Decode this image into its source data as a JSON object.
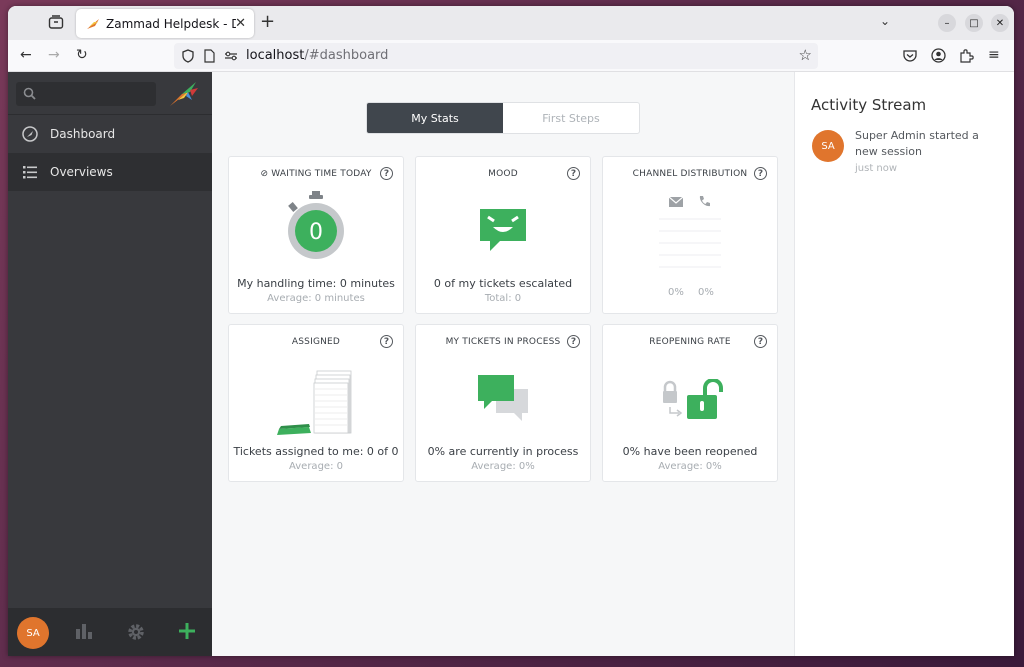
{
  "browser": {
    "tab_title": "Zammad Helpdesk - Dash",
    "url_host": "localhost",
    "url_path": "/#dashboard"
  },
  "sidebar": {
    "items": [
      {
        "label": "Dashboard",
        "icon": "dashboard-icon"
      },
      {
        "label": "Overviews",
        "icon": "list-icon"
      }
    ],
    "avatar_initials": "SA"
  },
  "dashboard": {
    "toggle": {
      "left": "My Stats",
      "right": "First Steps",
      "active": "left"
    },
    "cards": [
      {
        "title": "WAITING TIME TODAY",
        "main": "My handling time: 0 minutes",
        "sub": "Average: 0 minutes",
        "value": "0"
      },
      {
        "title": "MOOD",
        "main": "0 of my tickets escalated",
        "sub": "Total: 0"
      },
      {
        "title": "CHANNEL DISTRIBUTION",
        "pct_email": "0%",
        "pct_phone": "0%"
      },
      {
        "title": "ASSIGNED",
        "main": "Tickets assigned to me: 0 of 0",
        "sub": "Average: 0"
      },
      {
        "title": "MY TICKETS IN PROCESS",
        "main": "0% are currently in process",
        "sub": "Average: 0%"
      },
      {
        "title": "REOPENING RATE",
        "main": "0% have been reopened",
        "sub": "Average: 0%"
      }
    ]
  },
  "activity": {
    "title": "Activity Stream",
    "entries": [
      {
        "initials": "SA",
        "text": "Super Admin started a new session",
        "time": "just now"
      }
    ]
  },
  "colors": {
    "green": "#3db05d",
    "orange": "#e0752d",
    "sidebar": "#38393d"
  }
}
